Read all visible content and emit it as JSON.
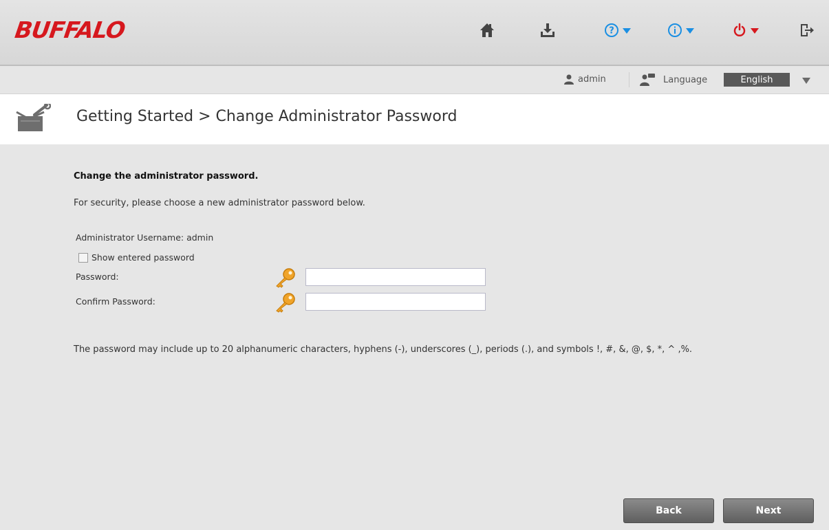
{
  "header": {
    "logo": "BUFFALO",
    "icons": [
      "home-icon",
      "download-icon",
      "help-icon",
      "info-icon",
      "power-icon",
      "logout-icon"
    ],
    "colors": {
      "brand": "#d6181e",
      "accent": "#1a8fe3",
      "power": "#d6181e"
    }
  },
  "userbar": {
    "user": "admin",
    "language_label": "Language",
    "language_value": "English"
  },
  "page": {
    "title": "Getting Started > Change Administrator Password"
  },
  "form": {
    "heading": "Change the administrator password.",
    "intro": "For security, please choose a new administrator password below.",
    "username_line": "Administrator Username: admin",
    "show_password_label": "Show entered password",
    "password_label": "Password:",
    "confirm_label": "Confirm Password:",
    "password_value": "",
    "confirm_value": "",
    "note": "The password may include up to 20 alphanumeric characters, hyphens (-), underscores (_), periods (.), and symbols !, #, &, @, $, *, ^ ,%."
  },
  "buttons": {
    "back": "Back",
    "next": "Next"
  }
}
